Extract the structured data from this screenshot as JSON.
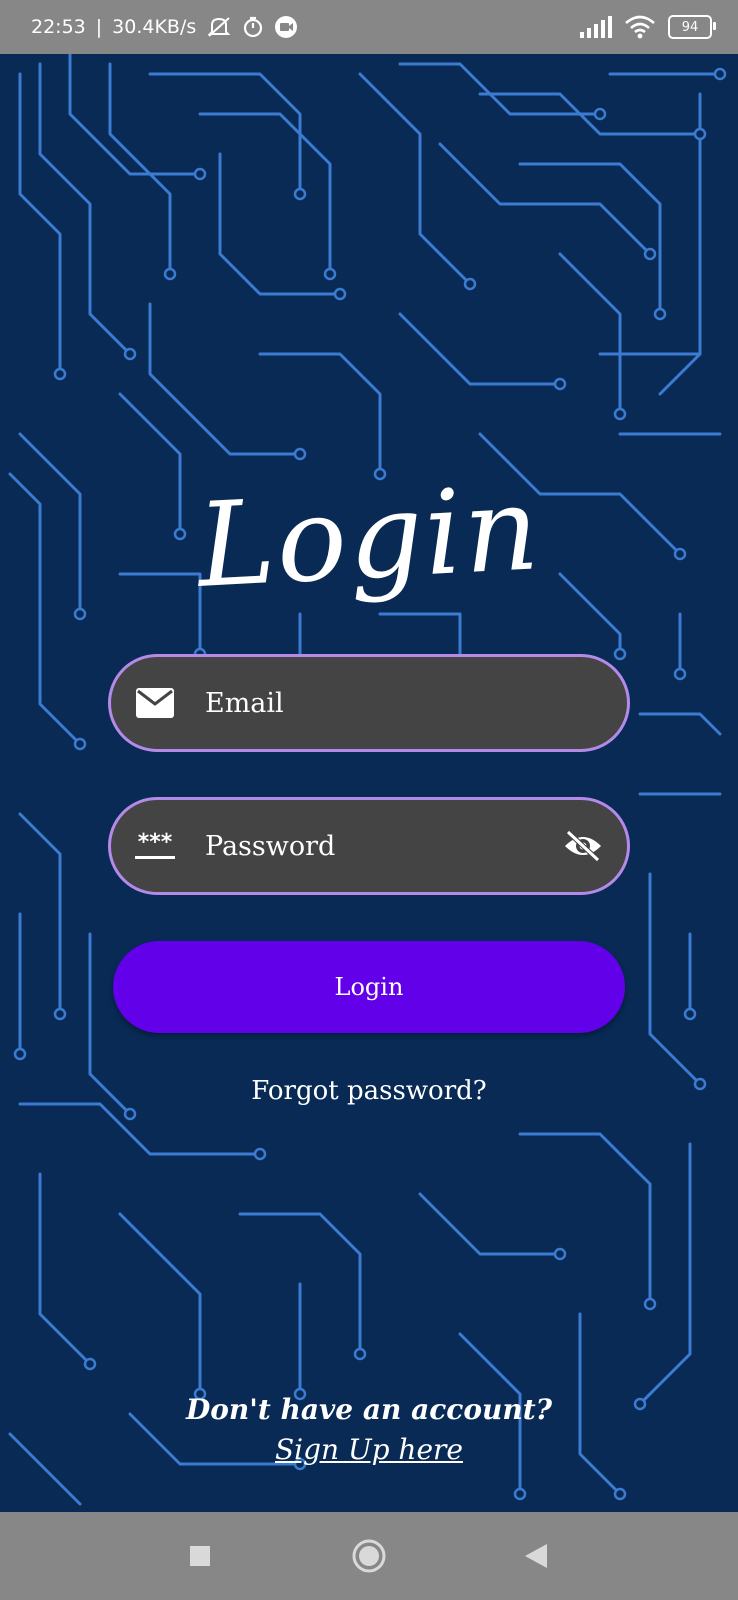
{
  "status_bar": {
    "time": "22:53",
    "separator": "|",
    "net_speed": "30.4KB/s",
    "battery": "94"
  },
  "screen": {
    "title": "Login",
    "email_field": {
      "placeholder": "Email"
    },
    "password_field": {
      "mask_icon_text": "***",
      "placeholder": "Password"
    },
    "login_button_label": "Login",
    "forgot_password": "Forgot password?",
    "no_account_text": "Don't have an account?",
    "signup_link": "Sign Up here"
  },
  "colors": {
    "background": "#082a55",
    "circuit_lines": "#3b7bd1",
    "field_bg": "#444444",
    "field_border": "#b48ae8",
    "button_bg": "#6200ea",
    "system_bars": "#878787"
  },
  "icons": {
    "email": "mail-icon",
    "password": "password-mask-icon",
    "visibility": "eye-off-icon",
    "nav_recent": "square-icon",
    "nav_home": "circle-icon",
    "nav_back": "triangle-back-icon"
  }
}
